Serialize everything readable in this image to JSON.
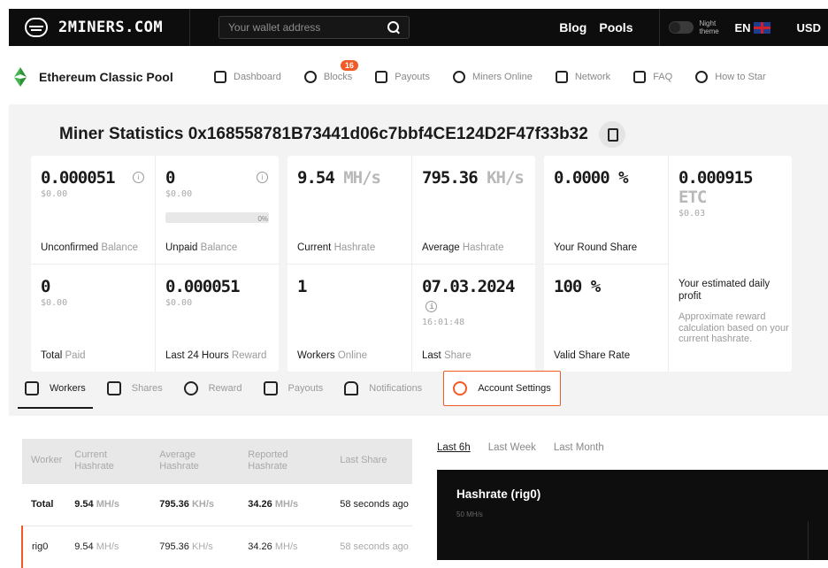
{
  "topbar": {
    "brand": "2MINERS.COM",
    "search_placeholder": "Your wallet address",
    "links": [
      "Blog",
      "Pools"
    ],
    "night_theme": "Night theme",
    "language": "EN",
    "currency": "USD"
  },
  "poolnav": {
    "title": "Ethereum Classic Pool",
    "items": [
      {
        "label": "Dashboard",
        "icon": "home-icon"
      },
      {
        "label": "Blocks",
        "icon": "cube-icon",
        "badge": "16"
      },
      {
        "label": "Payouts",
        "icon": "wallet-icon"
      },
      {
        "label": "Miners Online",
        "icon": "users-icon"
      },
      {
        "label": "Network",
        "icon": "monitor-icon"
      },
      {
        "label": "FAQ",
        "icon": "chat-icon"
      },
      {
        "label": "How to Star",
        "icon": "question-icon"
      }
    ]
  },
  "stats": {
    "title": "Miner Statistics 0x168558781B73441d06c7bbf4CE124D2F47f33b32",
    "unconfirmed": {
      "value": "0.000051",
      "usd": "$0.00",
      "label": "Unconfirmed",
      "label_mute": "Balance"
    },
    "unpaid": {
      "value": "0",
      "usd": "$0.00",
      "percent_text": "0%",
      "progress": 0,
      "label": "Unpaid",
      "label_mute": "Balance"
    },
    "total_paid": {
      "value": "0",
      "usd": "$0.00",
      "label": "Total",
      "label_mute": "Paid"
    },
    "last24": {
      "value": "0.000051",
      "usd": "$0.00",
      "label": "Last 24 Hours",
      "label_mute": "Reward"
    },
    "current_hashrate": {
      "value": "9.54",
      "unit": "MH/s",
      "label": "Current",
      "label_mute": "Hashrate"
    },
    "average_hashrate": {
      "value": "795.36",
      "unit": "KH/s",
      "label": "Average",
      "label_mute": "Hashrate"
    },
    "workers_online": {
      "value": "1",
      "label": "Workers",
      "label_mute": "Online"
    },
    "last_share": {
      "value": "07.03.2024",
      "time": "16:01:48",
      "label": "Last",
      "label_mute": "Share"
    },
    "round_share": {
      "value": "0.0000 %",
      "label": "Your Round Share"
    },
    "valid_share": {
      "value": "100 %",
      "label": "Valid Share Rate"
    },
    "daily_profit": {
      "value": "0.000915",
      "unit": "ETC",
      "usd": "$0.03",
      "label": "Your estimated daily profit",
      "note": "Approximate reward calculation based on your current hashrate."
    }
  },
  "tabs": [
    "Workers",
    "Shares",
    "Reward",
    "Payouts",
    "Notifications",
    "Account Settings"
  ],
  "workers_table": {
    "headers": [
      "Worker",
      "Current Hashrate",
      "Average Hashrate",
      "Reported Hashrate",
      "Last Share"
    ],
    "rows": [
      {
        "worker": "Total",
        "current": "9.54",
        "current_unit": "MH/s",
        "average": "795.36",
        "average_unit": "KH/s",
        "reported": "34.26",
        "reported_unit": "MH/s",
        "last": "58 seconds ago"
      },
      {
        "worker": "rig0",
        "current": "9.54",
        "current_unit": "MH/s",
        "average": "795.36",
        "average_unit": "KH/s",
        "reported": "34.26",
        "reported_unit": "MH/s",
        "last": "58 seconds ago"
      }
    ]
  },
  "chart": {
    "tabs": [
      "Last 6h",
      "Last Week",
      "Last Month"
    ],
    "title": "Hashrate (rig0)",
    "y_top_label": "50 MH/s"
  },
  "colors": {
    "accent": "#f15a24",
    "topbar": "#0d0d0d",
    "panel": "#f3f3f3"
  }
}
